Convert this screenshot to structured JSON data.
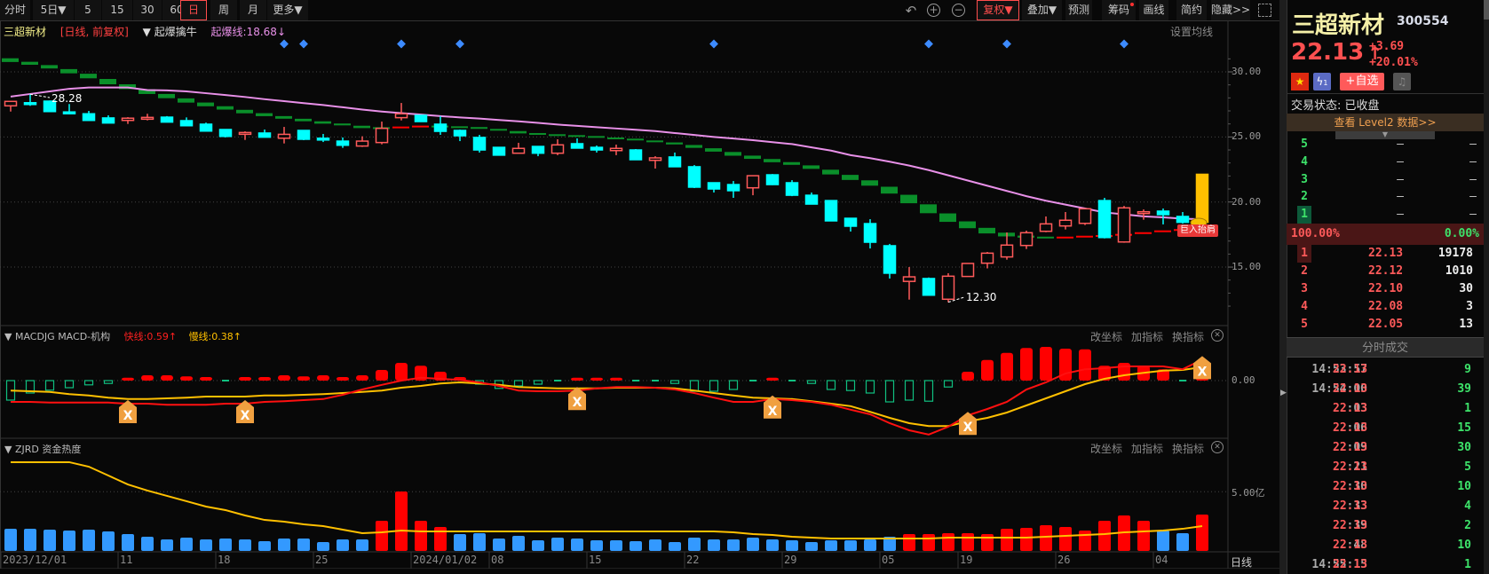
{
  "toolbar": {
    "periods": [
      {
        "label": "分时"
      },
      {
        "label": "5日▼"
      },
      {
        "label": "5"
      },
      {
        "label": "15"
      },
      {
        "label": "30"
      },
      {
        "label": "60"
      },
      {
        "label": "日",
        "active": true
      },
      {
        "label": "周"
      },
      {
        "label": "月"
      },
      {
        "label": "更多▼"
      }
    ],
    "icons": [
      "undo-icon",
      "zoom-in-icon",
      "zoom-out-icon"
    ],
    "right_buttons": [
      {
        "label": "复权▼",
        "active": true
      },
      {
        "label": "叠加▼"
      },
      {
        "label": "预测"
      },
      {
        "label": "筹码",
        "dot": true
      },
      {
        "label": "画线"
      },
      {
        "label": "简约"
      },
      {
        "label": "隐藏>>"
      }
    ]
  },
  "main_chart": {
    "stock_name": "三超新材",
    "period_tag": "[日线, 前复权]",
    "indicator": "▼ 起爆擒牛",
    "indicator_value": "起爆线:18.68↓",
    "ma_setting": "设置均线",
    "high_label": "28.28",
    "low_label": "12.30",
    "signal_badge": "巨入抬肩",
    "y_ticks": [
      "30.00",
      "25.00",
      "20.00",
      "15.00"
    ],
    "y_tick_values": [
      30,
      25,
      20,
      15
    ],
    "signal_markers": [
      14,
      15,
      20,
      23,
      36,
      47,
      51,
      57
    ]
  },
  "macd_panel": {
    "title": "▼ MACDJG MACD-机构",
    "fast": "快线:0.59↑",
    "slow": "慢线:0.38↑",
    "zero_tick": "0.00",
    "buttons": [
      "改坐标",
      "加指标",
      "换指标"
    ],
    "cross_markers": [
      6,
      12,
      29,
      39,
      49,
      61
    ]
  },
  "zjrd_panel": {
    "title": "▼ ZJRD 资金热度",
    "tick": "5.00亿",
    "buttons": [
      "改坐标",
      "加指标",
      "换指标"
    ]
  },
  "x_axis": {
    "labels": [
      {
        "text": "2023/12/01",
        "idx": 0
      },
      {
        "text": "11",
        "idx": 6
      },
      {
        "text": "18",
        "idx": 11
      },
      {
        "text": "25",
        "idx": 16
      },
      {
        "text": "2024/01/02",
        "idx": 21
      },
      {
        "text": "08",
        "idx": 25
      },
      {
        "text": "15",
        "idx": 30
      },
      {
        "text": "22",
        "idx": 35
      },
      {
        "text": "29",
        "idx": 40
      },
      {
        "text": "05",
        "idx": 45
      },
      {
        "text": "19",
        "idx": 49
      },
      {
        "text": "26",
        "idx": 54
      },
      {
        "text": "04",
        "idx": 59
      }
    ],
    "period": "日线"
  },
  "chart_data": {
    "type": "candlestick",
    "ylim": [
      10.8,
      31.5
    ],
    "candles": [
      [
        27.39,
        27.73,
        27.73,
        26.95
      ],
      [
        27.63,
        27.6,
        28.28,
        27.39
      ],
      [
        27.75,
        26.95,
        27.8,
        26.95
      ],
      [
        26.92,
        26.88,
        27.53,
        26.73
      ],
      [
        26.78,
        26.27,
        27.0,
        26.27
      ],
      [
        26.46,
        26.07,
        26.66,
        26.07
      ],
      [
        26.27,
        26.44,
        26.52,
        26.0
      ],
      [
        26.46,
        26.5,
        26.78,
        26.27
      ],
      [
        26.52,
        26.14,
        26.6,
        26.14
      ],
      [
        26.25,
        25.86,
        26.5,
        25.86
      ],
      [
        25.98,
        25.45,
        26.1,
        25.45
      ],
      [
        25.57,
        25.04,
        25.57,
        24.96
      ],
      [
        25.3,
        25.34,
        25.43,
        24.77
      ],
      [
        25.3,
        24.98,
        25.57,
        24.98
      ],
      [
        24.9,
        25.2,
        25.77,
        24.5
      ],
      [
        25.5,
        24.82,
        25.5,
        24.75
      ],
      [
        24.9,
        24.88,
        25.23,
        24.61
      ],
      [
        24.68,
        24.36,
        24.96,
        24.16
      ],
      [
        24.3,
        24.68,
        25.05,
        24.23
      ],
      [
        24.57,
        25.66,
        26.18,
        24.43
      ],
      [
        26.48,
        26.78,
        27.61,
        26.27
      ],
      [
        26.66,
        26.18,
        26.7,
        26.18
      ],
      [
        25.98,
        25.43,
        26.6,
        25.16
      ],
      [
        25.5,
        25.09,
        25.57,
        24.68
      ],
      [
        24.96,
        24.0,
        25.16,
        23.8
      ],
      [
        24.2,
        23.6,
        24.2,
        23.6
      ],
      [
        23.75,
        24.12,
        24.55,
        23.75
      ],
      [
        24.27,
        23.75,
        24.27,
        23.52
      ],
      [
        23.75,
        24.39,
        24.82,
        23.6
      ],
      [
        24.48,
        24.14,
        24.89,
        24.14
      ],
      [
        24.2,
        24.0,
        24.34,
        23.8
      ],
      [
        23.95,
        24.12,
        24.41,
        23.6
      ],
      [
        24.0,
        23.25,
        24.07,
        23.25
      ],
      [
        23.2,
        23.39,
        23.52,
        22.57
      ],
      [
        23.46,
        22.71,
        23.8,
        22.71
      ],
      [
        22.71,
        21.14,
        22.84,
        21.07
      ],
      [
        21.48,
        21.0,
        21.48,
        20.73
      ],
      [
        21.34,
        20.87,
        21.61,
        20.32
      ],
      [
        21.09,
        22.02,
        22.02,
        20.52
      ],
      [
        22.09,
        21.34,
        22.15,
        21.3
      ],
      [
        21.48,
        20.52,
        21.68,
        20.45
      ],
      [
        20.52,
        19.84,
        20.73,
        19.84
      ],
      [
        20.11,
        18.55,
        20.11,
        18.55
      ],
      [
        18.75,
        18.14,
        18.75,
        17.73
      ],
      [
        18.34,
        16.91,
        18.68,
        16.43
      ],
      [
        16.64,
        14.53,
        16.78,
        14.12
      ],
      [
        13.9,
        14.25,
        15.0,
        12.5
      ],
      [
        14.12,
        12.84,
        14.2,
        12.84
      ],
      [
        12.53,
        14.3,
        14.53,
        12.3
      ],
      [
        14.28,
        15.28,
        15.3,
        14.28
      ],
      [
        15.3,
        16.07,
        16.16,
        14.9
      ],
      [
        15.78,
        16.69,
        17.66,
        15.57
      ],
      [
        16.66,
        17.64,
        17.8,
        16.39
      ],
      [
        17.75,
        18.32,
        18.89,
        17.68
      ],
      [
        18.16,
        18.6,
        19.23,
        17.89
      ],
      [
        18.36,
        19.48,
        19.48,
        18.23
      ],
      [
        20.11,
        17.27,
        20.32,
        17.2
      ],
      [
        16.93,
        19.55,
        19.7,
        16.87
      ],
      [
        19.2,
        19.25,
        19.43,
        18.64
      ],
      [
        19.3,
        19.03,
        19.5,
        18.28
      ],
      [
        18.89,
        18.44,
        19.23,
        18.34
      ],
      [
        18.44,
        22.13,
        22.13,
        18.44
      ]
    ],
    "limit_up_index": 61,
    "ma_line": [
      28.1,
      28.3,
      28.5,
      28.7,
      28.8,
      28.8,
      28.8,
      28.6,
      28.58,
      28.5,
      28.36,
      28.22,
      28.07,
      27.9,
      27.75,
      27.6,
      27.45,
      27.28,
      27.1,
      26.95,
      26.83,
      26.72,
      26.6,
      26.5,
      26.41,
      26.3,
      26.2,
      26.08,
      25.95,
      25.85,
      25.75,
      25.65,
      25.55,
      25.45,
      25.3,
      25.15,
      25.0,
      24.88,
      24.75,
      24.6,
      24.45,
      24.2,
      23.95,
      23.6,
      23.37,
      23.1,
      22.8,
      22.45,
      22.05,
      21.65,
      21.25,
      20.85,
      20.45,
      20.1,
      19.8,
      19.5,
      19.2,
      19.05,
      18.9,
      18.82,
      18.72,
      18.68
    ],
    "signal_line": [
      30.9,
      30.66,
      30.39,
      30.05,
      29.68,
      29.25,
      28.86,
      28.48,
      28.14,
      27.8,
      27.5,
      27.23,
      26.95,
      26.71,
      26.5,
      26.3,
      26.11,
      25.96,
      25.77,
      25.68,
      25.73,
      25.8,
      25.8,
      25.75,
      25.69,
      25.55,
      25.36,
      25.23,
      25.14,
      25.07,
      25.0,
      24.89,
      24.8,
      24.66,
      24.5,
      24.27,
      24.0,
      23.7,
      23.44,
      23.18,
      22.96,
      22.68,
      22.3,
      21.89,
      21.46,
      20.91,
      20.23,
      19.48,
      18.8,
      18.25,
      17.8,
      17.5,
      17.34,
      17.27,
      17.27,
      17.34,
      17.39,
      17.48,
      17.61,
      17.75,
      17.85,
      18.0
    ],
    "signal_line_red_indices": [
      20,
      21,
      54,
      55,
      56,
      57,
      58,
      59,
      60,
      61
    ],
    "macd_hist": [
      -0.55,
      -0.35,
      -0.27,
      -0.2,
      -0.12,
      -0.08,
      0.08,
      0.15,
      0.15,
      0.12,
      0.1,
      -0.03,
      0.1,
      0.1,
      0.15,
      0.12,
      0.15,
      0.1,
      0.15,
      0.3,
      0.5,
      0.42,
      0.25,
      0.1,
      -0.1,
      -0.22,
      -0.15,
      -0.1,
      -0.02,
      0.08,
      0.08,
      0.08,
      -0.03,
      -0.03,
      -0.08,
      -0.3,
      -0.3,
      -0.25,
      -0.02,
      0.08,
      -0.02,
      -0.08,
      -0.25,
      -0.28,
      -0.35,
      -0.6,
      -0.55,
      -0.58,
      -0.18,
      0.25,
      0.58,
      0.78,
      0.92,
      0.95,
      0.9,
      0.88,
      0.42,
      0.5,
      0.42,
      0.32,
      -0.03,
      0.08
    ],
    "macd_dif": [
      -0.6,
      -0.6,
      -0.62,
      -0.62,
      -0.62,
      -0.62,
      -0.65,
      -0.65,
      -0.68,
      -0.68,
      -0.68,
      -0.65,
      -0.65,
      -0.6,
      -0.58,
      -0.55,
      -0.52,
      -0.4,
      -0.25,
      -0.12,
      0.0,
      0.08,
      0.05,
      0.02,
      -0.05,
      -0.15,
      -0.28,
      -0.3,
      -0.3,
      -0.28,
      -0.22,
      -0.18,
      -0.18,
      -0.2,
      -0.25,
      -0.35,
      -0.48,
      -0.6,
      -0.6,
      -0.52,
      -0.55,
      -0.6,
      -0.68,
      -0.82,
      -0.95,
      -1.2,
      -1.4,
      -1.52,
      -1.3,
      -0.98,
      -0.8,
      -0.6,
      -0.25,
      -0.05,
      0.2,
      0.32,
      0.35,
      0.4,
      0.4,
      0.4,
      0.32,
      0.59
    ],
    "macd_dea": [
      -0.28,
      -0.3,
      -0.32,
      -0.38,
      -0.42,
      -0.48,
      -0.52,
      -0.52,
      -0.5,
      -0.48,
      -0.45,
      -0.45,
      -0.45,
      -0.42,
      -0.42,
      -0.4,
      -0.38,
      -0.35,
      -0.32,
      -0.28,
      -0.2,
      -0.15,
      -0.08,
      -0.05,
      -0.08,
      -0.12,
      -0.18,
      -0.2,
      -0.22,
      -0.22,
      -0.22,
      -0.2,
      -0.2,
      -0.2,
      -0.22,
      -0.28,
      -0.35,
      -0.42,
      -0.48,
      -0.5,
      -0.52,
      -0.58,
      -0.65,
      -0.72,
      -0.88,
      -1.05,
      -1.2,
      -1.28,
      -1.28,
      -1.15,
      -1.05,
      -0.9,
      -0.7,
      -0.5,
      -0.3,
      -0.1,
      0.05,
      0.15,
      0.22,
      0.28,
      0.3,
      0.38
    ],
    "zjrd_bars": [
      1.87,
      1.87,
      1.8,
      1.72,
      1.8,
      1.65,
      1.42,
      1.2,
      0.97,
      1.12,
      0.97,
      1.05,
      0.97,
      0.82,
      1.05,
      1.05,
      0.75,
      0.97,
      0.97,
      2.55,
      5.02,
      2.55,
      2.02,
      1.42,
      1.5,
      1.05,
      1.27,
      0.9,
      1.12,
      1.05,
      0.9,
      0.9,
      0.82,
      0.97,
      0.75,
      1.12,
      0.97,
      0.97,
      1.12,
      0.97,
      0.9,
      0.75,
      0.9,
      0.9,
      0.97,
      1.2,
      1.42,
      1.42,
      1.5,
      1.5,
      1.42,
      1.87,
      1.95,
      2.17,
      2.02,
      1.72,
      2.55,
      3.0,
      2.55,
      1.72,
      1.5,
      3.07
    ],
    "zjrd_red_indices": [
      19,
      20,
      21,
      22,
      46,
      47,
      48,
      49,
      50,
      51,
      52,
      53,
      54,
      55,
      56,
      57,
      58,
      61
    ],
    "zjrd_line": [
      7.5,
      7.5,
      7.5,
      7.5,
      7.12,
      6.37,
      5.62,
      5.1,
      4.65,
      4.2,
      3.75,
      3.45,
      3.0,
      2.62,
      2.47,
      2.25,
      2.1,
      1.8,
      1.5,
      1.57,
      1.72,
      1.65,
      1.65,
      1.65,
      1.65,
      1.65,
      1.65,
      1.65,
      1.65,
      1.65,
      1.65,
      1.65,
      1.65,
      1.65,
      1.65,
      1.65,
      1.65,
      1.57,
      1.42,
      1.35,
      1.2,
      1.12,
      1.05,
      1.05,
      1.05,
      1.05,
      1.05,
      1.05,
      1.12,
      1.12,
      1.12,
      1.12,
      1.12,
      1.2,
      1.27,
      1.35,
      1.42,
      1.57,
      1.65,
      1.72,
      1.87,
      2.1
    ]
  },
  "quote": {
    "name": "三超新材",
    "code": "300554",
    "price": "22.13",
    "arrow": "↑",
    "change": "+3.69",
    "change_pct": "+20.01%",
    "add_watch": "+自选",
    "lightning_count": "1",
    "status": "交易状态: 已收盘",
    "level2": "查看 Level2 数据>>",
    "asks": [
      {
        "level": "5",
        "price": "—",
        "vol": "—"
      },
      {
        "level": "4",
        "price": "—",
        "vol": "—"
      },
      {
        "level": "3",
        "price": "—",
        "vol": "—"
      },
      {
        "level": "2",
        "price": "—",
        "vol": "—"
      },
      {
        "level": "1",
        "price": "—",
        "vol": "—"
      }
    ],
    "buy_ratio": "100.00%",
    "sell_ratio": "0.00%",
    "bids": [
      {
        "level": "1",
        "price": "22.13",
        "vol": "19178"
      },
      {
        "level": "2",
        "price": "22.12",
        "vol": "1010"
      },
      {
        "level": "3",
        "price": "22.10",
        "vol": "30"
      },
      {
        "level": "4",
        "price": "22.08",
        "vol": "3"
      },
      {
        "level": "5",
        "price": "22.05",
        "vol": "13"
      }
    ],
    "trades_title": "分时成交",
    "trades": [
      {
        "time": "14:53:57",
        "price": "22.13",
        "vol": "9"
      },
      {
        "time": "14:54:00",
        "price": "22.13",
        "vol": "39"
      },
      {
        "time": ":03",
        "price": "22.13",
        "vol": "1"
      },
      {
        "time": ":06",
        "price": "22.13",
        "vol": "15"
      },
      {
        "time": ":09",
        "price": "22.13",
        "vol": "30"
      },
      {
        "time": ":21",
        "price": "22.13",
        "vol": "5"
      },
      {
        "time": ":30",
        "price": "22.13",
        "vol": "10"
      },
      {
        "time": ":33",
        "price": "22.13",
        "vol": "4"
      },
      {
        "time": ":39",
        "price": "22.13",
        "vol": "2"
      },
      {
        "time": ":48",
        "price": "22.13",
        "vol": "10"
      },
      {
        "time": "14:55:15",
        "price": "22.13",
        "vol": "1"
      }
    ]
  },
  "colors": {
    "up": "#ff5a5a",
    "down": "#00ffff",
    "limit": "#ffc000",
    "band_green": "#0a8f2a",
    "band_red": "#ff0000",
    "ma": "#e890e8",
    "dif": "#ff1010",
    "dea": "#ffc000",
    "zjrd_blue": "#3399ff"
  }
}
